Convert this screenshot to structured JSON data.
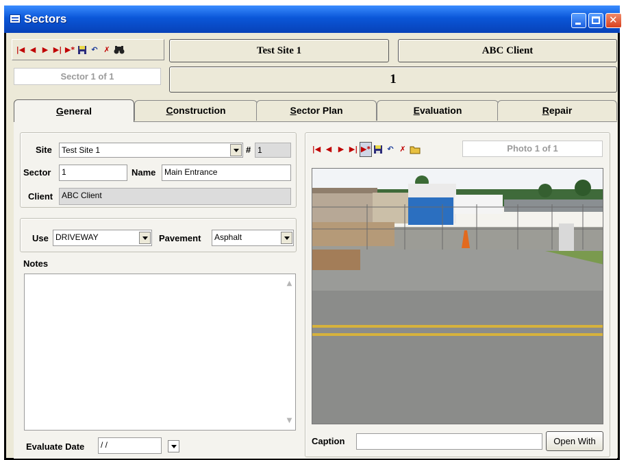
{
  "window": {
    "title": "Sectors"
  },
  "header": {
    "site": "Test Site 1",
    "client": "ABC Client",
    "sector_number": "1",
    "record_counter": "Sector 1 of 1"
  },
  "tabs": [
    {
      "label": "General",
      "hotkey": "G",
      "rest": "eneral"
    },
    {
      "label": "Construction",
      "hotkey": "C",
      "rest": "onstruction"
    },
    {
      "label": "Sector Plan",
      "hotkey": "S",
      "rest": "ector Plan"
    },
    {
      "label": "Evaluation",
      "hotkey": "E",
      "rest": "valuation"
    },
    {
      "label": "Repair",
      "hotkey": "R",
      "rest": "epair"
    }
  ],
  "general": {
    "site_label": "Site",
    "site_value": "Test Site 1",
    "num_label": "#",
    "num_value": "1",
    "sector_label": "Sector",
    "sector_value": "1",
    "name_label": "Name",
    "name_value": "Main Entrance",
    "client_label": "Client",
    "client_value": "ABC Client",
    "use_label": "Use",
    "use_value": "DRIVEWAY",
    "pavement_label": "Pavement",
    "pavement_value": "Asphalt",
    "notes_label": "Notes",
    "notes_value": "",
    "evaluate_label": "Evaluate Date",
    "evaluate_value": " / /"
  },
  "photo": {
    "record_counter": "Photo 1 of 1",
    "caption_label": "Caption",
    "caption_value": "",
    "open_with_label": "Open With"
  },
  "nav_icons": [
    "first-record-icon",
    "prev-record-icon",
    "next-record-icon",
    "last-record-icon",
    "new-record-icon",
    "save-record-icon",
    "undo-icon",
    "delete-record-icon",
    "find-icon"
  ],
  "colors": {
    "titlebar": "#0a56d8",
    "nav_red": "#c00000",
    "window_bg": "#ece9d8"
  }
}
